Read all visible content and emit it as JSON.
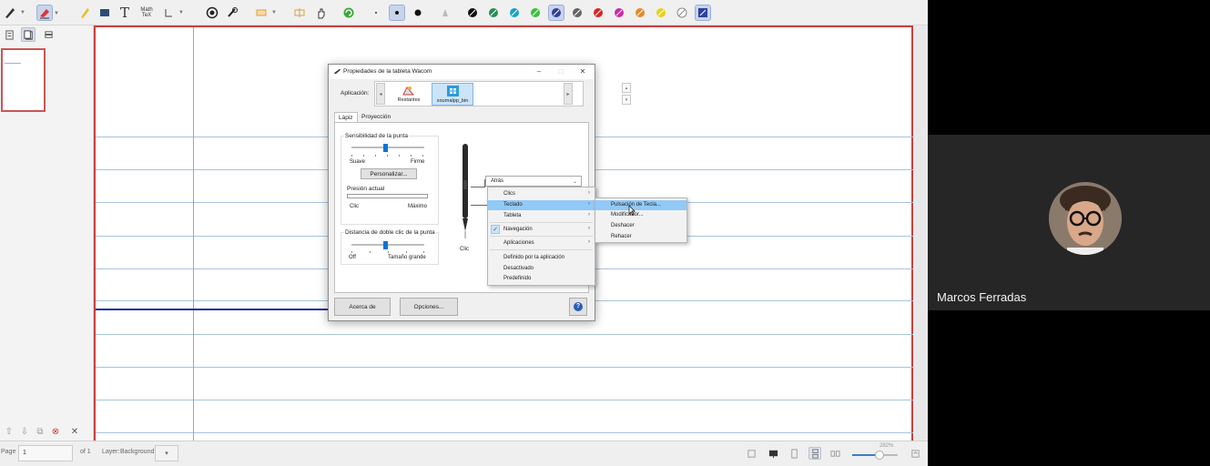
{
  "wacom": {
    "title": "Propiedades de la tableta Wacom",
    "app_label": "Aplicación:",
    "apps": [
      "Restantes",
      "xournalpp_bin"
    ],
    "tabs": [
      "Lápiz",
      "Proyección"
    ],
    "tip_feel": {
      "title": "Sensibilidad de la punta",
      "left": "Suave",
      "right": "Firme",
      "customize": "Personalizar...",
      "level": 0.45
    },
    "pressure": {
      "title": "Presión actual",
      "left": "Clic",
      "right": "Máximo"
    },
    "double_click": {
      "title": "Distancia de doble clic de la punta",
      "left": "Off",
      "right": "Tamaño grande",
      "level": 0.45
    },
    "pen_tip_label": "Clic",
    "button_select": "Atrás",
    "about": "Acerca de",
    "options": "Opciones...",
    "help": "?"
  },
  "menu": {
    "items": [
      "Clics",
      "Teclado",
      "Tableta",
      "Navegación",
      "Aplicaciones",
      "Definido por la aplicación",
      "Desactivado",
      "Predefinido"
    ],
    "checked": "Navegación",
    "highlighted": "Teclado"
  },
  "submenu": {
    "items": [
      "Pulsación de Tecla...",
      "Modificador...",
      "Deshacer",
      "Rehacer"
    ],
    "highlighted": "Pulsación de Tecla..."
  },
  "statusbar": {
    "page_label": "Page",
    "page_value": "1",
    "of_label": "of 1",
    "layer_label": "Layer:",
    "layer_value": "Background",
    "zoom_value": "282%",
    "zoom_level": 0.6
  },
  "video": {
    "participant_name": "Marcos Ferradas"
  },
  "colors": {
    "page_border": "#c84040",
    "rule_line": "#a9c3df",
    "margin_line": "#d98aa6",
    "pen_stroke": "#2a30a8",
    "selection_blue": "#0078d7"
  }
}
